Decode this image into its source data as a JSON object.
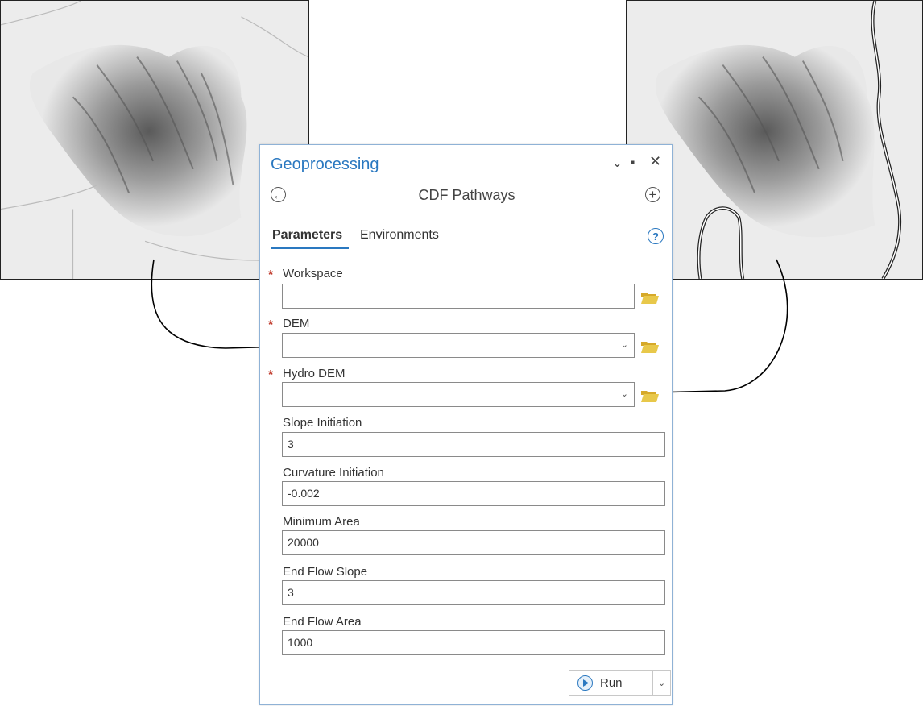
{
  "panel": {
    "title": "Geoprocessing",
    "tool_name": "CDF Pathways",
    "tabs": [
      {
        "label": "Parameters",
        "active": true
      },
      {
        "label": "Environments",
        "active": false
      }
    ],
    "help_glyph": "?",
    "required_marker": "*",
    "params": [
      {
        "label": "Workspace",
        "value": "",
        "required": true,
        "type": "folder"
      },
      {
        "label": "DEM",
        "value": "",
        "required": true,
        "type": "dropdown-folder"
      },
      {
        "label": "Hydro DEM",
        "value": "",
        "required": true,
        "type": "dropdown-folder"
      },
      {
        "label": "Slope Initiation",
        "value": "3",
        "required": false,
        "type": "text"
      },
      {
        "label": "Curvature Initiation",
        "value": "-0.002",
        "required": false,
        "type": "text"
      },
      {
        "label": "Minimum Area",
        "value": "20000",
        "required": false,
        "type": "text"
      },
      {
        "label": "End Flow Slope",
        "value": "3",
        "required": false,
        "type": "text"
      },
      {
        "label": "End Flow Area",
        "value": "1000",
        "required": false,
        "type": "text"
      }
    ],
    "run_label": "Run"
  },
  "icons": {
    "back": "back-arrow-icon",
    "add": "plus-circle-icon",
    "help": "help-icon",
    "folder": "folder-open-icon",
    "run": "play-icon",
    "window_controls": [
      "chevron-down-icon",
      "maximize-icon",
      "close-icon"
    ]
  },
  "colors": {
    "accent": "#2a78c0",
    "required": "#c0392b",
    "folder": "#e8c84a"
  }
}
